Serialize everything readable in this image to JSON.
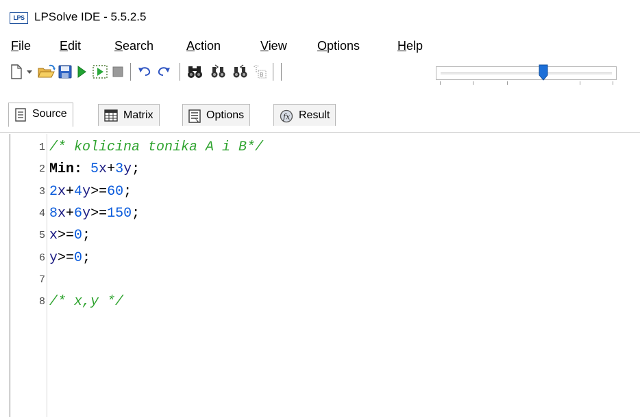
{
  "window": {
    "app_icon_text": "LPS",
    "title": "LPSolve IDE - 5.5.2.5"
  },
  "menu": [
    {
      "u": "F",
      "rest": "ile"
    },
    {
      "u": "E",
      "rest": "dit"
    },
    {
      "u": "S",
      "rest": "earch"
    },
    {
      "u": "A",
      "rest": "ction"
    },
    {
      "u": "V",
      "rest": "iew"
    },
    {
      "u": "O",
      "rest": "ptions"
    },
    {
      "u": "H",
      "rest": "elp"
    }
  ],
  "toolbar": {
    "icons": [
      "new-file-icon",
      "dropdown-arrow-icon",
      "open-folder-icon",
      "save-icon",
      "run-icon",
      "step-icon",
      "stop-icon",
      "undo-icon",
      "redo-icon",
      "find-icon",
      "find-next-icon",
      "replace-icon",
      "b-icon"
    ],
    "slider_level": 0.6
  },
  "tabs": [
    {
      "label": "Source",
      "icon": "document-icon",
      "active": true
    },
    {
      "label": "Matrix",
      "icon": "grid-icon",
      "active": false
    },
    {
      "label": "Options",
      "icon": "options-icon",
      "active": false
    },
    {
      "label": "Result",
      "icon": "result-icon",
      "active": false
    }
  ],
  "editor": {
    "line_numbers": [
      "1",
      "2",
      "3",
      "4",
      "5",
      "6",
      "7",
      "8"
    ],
    "lines": [
      [
        {
          "t": "/* kolicina tonika A i B*/",
          "c": "cm"
        }
      ],
      [
        {
          "t": "Min:",
          "c": "kw"
        },
        {
          "t": " ",
          "c": "op"
        },
        {
          "t": "5",
          "c": "nm"
        },
        {
          "t": "x",
          "c": "vr"
        },
        {
          "t": "+",
          "c": "op"
        },
        {
          "t": "3",
          "c": "nm"
        },
        {
          "t": "y",
          "c": "vr"
        },
        {
          "t": ";",
          "c": "op"
        }
      ],
      [
        {
          "t": "2",
          "c": "nm"
        },
        {
          "t": "x",
          "c": "vr"
        },
        {
          "t": "+",
          "c": "op"
        },
        {
          "t": "4",
          "c": "nm"
        },
        {
          "t": "y",
          "c": "vr"
        },
        {
          "t": ">=",
          "c": "op"
        },
        {
          "t": "60",
          "c": "nm"
        },
        {
          "t": ";",
          "c": "op"
        }
      ],
      [
        {
          "t": "8",
          "c": "nm"
        },
        {
          "t": "x",
          "c": "vr"
        },
        {
          "t": "+",
          "c": "op"
        },
        {
          "t": "6",
          "c": "nm"
        },
        {
          "t": "y",
          "c": "vr"
        },
        {
          "t": ">=",
          "c": "op"
        },
        {
          "t": "150",
          "c": "nm"
        },
        {
          "t": ";",
          "c": "op"
        }
      ],
      [
        {
          "t": "x",
          "c": "vr"
        },
        {
          "t": ">=",
          "c": "op"
        },
        {
          "t": "0",
          "c": "nm"
        },
        {
          "t": ";",
          "c": "op"
        }
      ],
      [
        {
          "t": "y",
          "c": "vr"
        },
        {
          "t": ">=",
          "c": "op"
        },
        {
          "t": "0",
          "c": "nm"
        },
        {
          "t": ";",
          "c": "op"
        }
      ],
      [],
      [
        {
          "t": "/* x,y */",
          "c": "cm"
        }
      ]
    ]
  }
}
